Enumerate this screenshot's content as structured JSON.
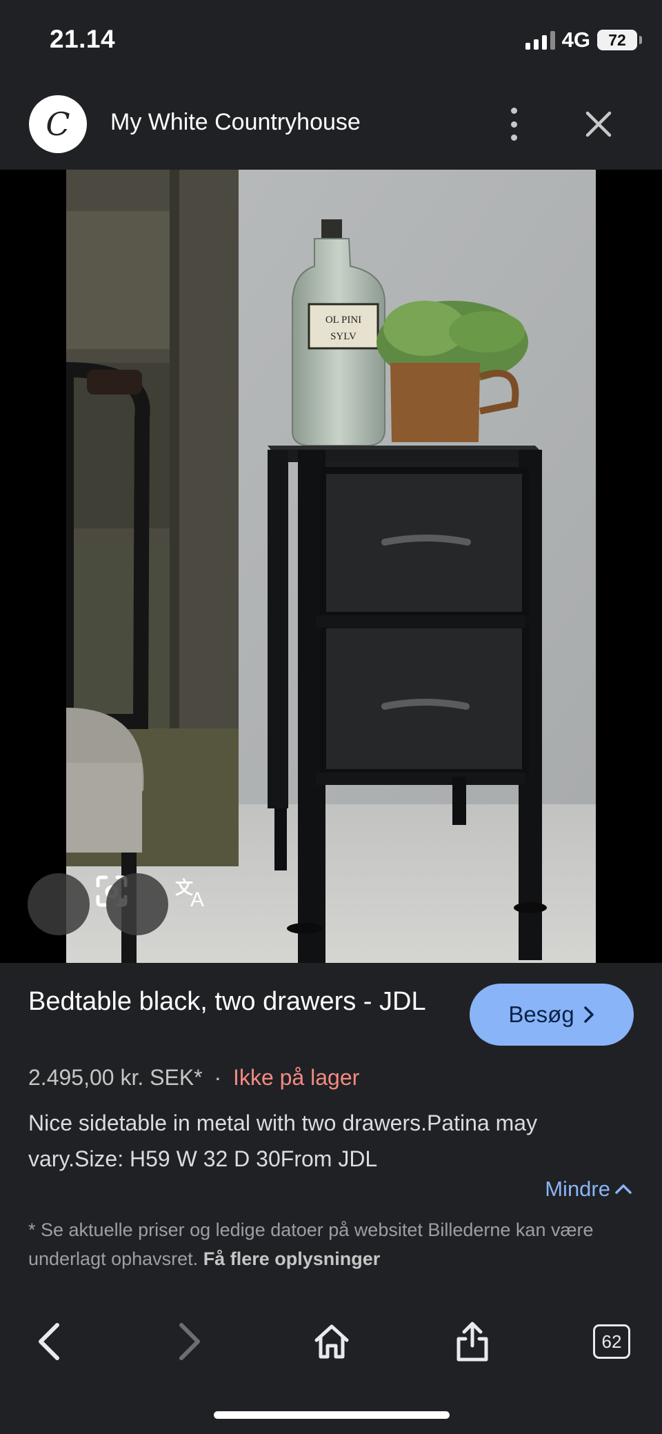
{
  "status_bar": {
    "time": "21.14",
    "network": "4G",
    "battery": "72"
  },
  "header": {
    "avatar_letter": "C",
    "site_name": "My White Countryhouse"
  },
  "image": {
    "bottle_label": "OL PINI SYLV"
  },
  "product": {
    "title": "Bedtable black, two drawers - JDL",
    "visit_label": "Besøg",
    "price": "2.495,00 kr. SEK*",
    "separator": "·",
    "stock": "Ikke på lager",
    "description": "Nice sidetable in metal with two drawers.Patina may vary.Size: H59 W 32 D 30From JDL",
    "less_label": "Mindre",
    "note_text": "* Se aktuelle priser og ledige datoer på websitet Billederne kan være underlagt ophavsret.",
    "note_link": "Få flere oplysninger"
  },
  "toolbar": {
    "tabs_count": "62"
  },
  "colors": {
    "background": "#202124",
    "accent": "#8ab4f8",
    "stock_red": "#f28b82"
  }
}
